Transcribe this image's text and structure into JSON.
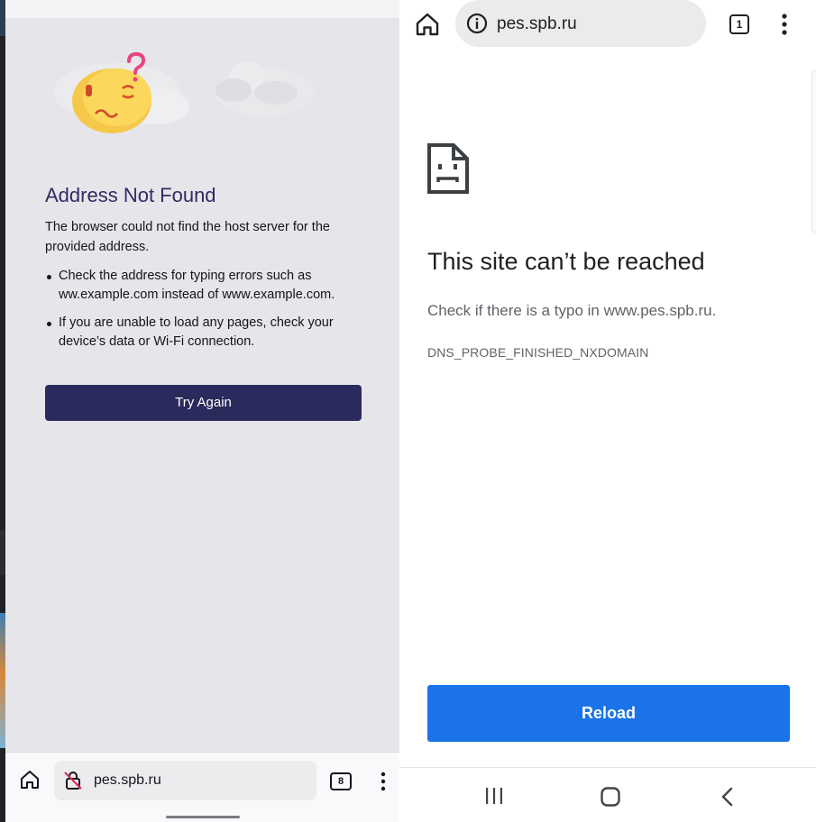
{
  "left_browser": {
    "error_title": "Address Not Found",
    "error_description": "The browser could not find the host server for the provided address.",
    "tips": [
      "Check the address for typing errors such as ww.example.com instead of www.example.com.",
      "If you are unable to load any pages, check your device’s data or Wi-Fi connection."
    ],
    "try_again_label": "Try Again",
    "url": "pes.spb.ru",
    "tab_count": "8",
    "icons": [
      "confused-emoji-icon",
      "home-icon",
      "insecure-lock-icon",
      "tabs-icon",
      "overflow-menu-icon"
    ],
    "colors": {
      "title": "#312a65",
      "button": "#2b2a5c",
      "background": "#e6e6ea"
    }
  },
  "right_browser": {
    "url": "pes.spb.ru",
    "tab_count": "1",
    "error_title": "This site can’t be reached",
    "error_description": "Check if there is a typo in www.pes.spb.ru.",
    "error_code": "DNS_PROBE_FINISHED_NXDOMAIN",
    "reload_label": "Reload",
    "icons": [
      "home-icon",
      "site-info-icon",
      "tabs-icon",
      "overflow-menu-icon",
      "sad-page-icon"
    ],
    "colors": {
      "button": "#1a73e8",
      "title": "#202124",
      "muted_text": "#5f6368"
    }
  },
  "system_nav": {
    "icons": [
      "recents-icon",
      "home-icon",
      "back-icon"
    ]
  }
}
